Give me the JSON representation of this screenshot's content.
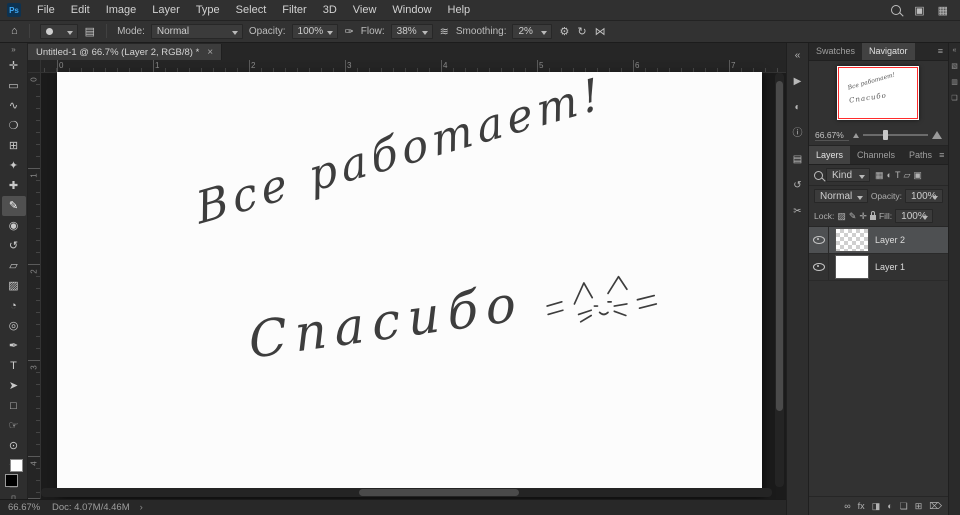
{
  "app": {
    "logo": "Ps"
  },
  "menubar": {
    "items": [
      "File",
      "Edit",
      "Image",
      "Layer",
      "Type",
      "Select",
      "Filter",
      "3D",
      "View",
      "Window",
      "Help"
    ],
    "workspace_icon": "▣",
    "arrange_icon": "▦"
  },
  "options": {
    "home_icon": "⌂",
    "brush_panel_icon": "▤",
    "mode": {
      "label": "Mode:",
      "value": "Normal"
    },
    "opacity": {
      "label": "Opacity:",
      "value": "100%"
    },
    "pressure_icon": "✑",
    "flow": {
      "label": "Flow:",
      "value": "38%"
    },
    "airbrush_icon": "≋",
    "smoothing": {
      "label": "Smoothing:",
      "value": "2%"
    },
    "gear_icon": "⚙",
    "angle_icon": "↻",
    "symmetry_icon": "⋈"
  },
  "tab": {
    "title": "Untitled-1 @ 66.7% (Layer 2, RGB/8) *",
    "close": "×"
  },
  "toolbar": {
    "collapse_icon": "»",
    "more_icon": "…",
    "tools": [
      {
        "name": "move-tool",
        "glyph": "✛",
        "selected": false
      },
      {
        "name": "marquee-tool",
        "glyph": "▭",
        "selected": false
      },
      {
        "name": "lasso-tool",
        "glyph": "∿",
        "selected": false
      },
      {
        "name": "quick-selection-tool",
        "glyph": "❍",
        "selected": false
      },
      {
        "name": "crop-tool",
        "glyph": "⊞",
        "selected": false
      },
      {
        "name": "eyedropper-tool",
        "glyph": "✦",
        "selected": false
      },
      {
        "name": "healing-brush-tool",
        "glyph": "✚",
        "selected": false
      },
      {
        "name": "brush-tool",
        "glyph": "✎",
        "selected": true
      },
      {
        "name": "clone-stamp-tool",
        "glyph": "◉",
        "selected": false
      },
      {
        "name": "history-brush-tool",
        "glyph": "↺",
        "selected": false
      },
      {
        "name": "eraser-tool",
        "glyph": "▱",
        "selected": false
      },
      {
        "name": "gradient-tool",
        "glyph": "▨",
        "selected": false
      },
      {
        "name": "blur-tool",
        "glyph": "◔",
        "selected": false
      },
      {
        "name": "dodge-tool",
        "glyph": "◎",
        "selected": false
      },
      {
        "name": "pen-tool",
        "glyph": "✒",
        "selected": false
      },
      {
        "name": "type-tool",
        "glyph": "T",
        "selected": false
      },
      {
        "name": "path-selection-tool",
        "glyph": "➤",
        "selected": false
      },
      {
        "name": "rectangle-tool",
        "glyph": "□",
        "selected": false
      },
      {
        "name": "hand-tool",
        "glyph": "☞",
        "selected": false
      },
      {
        "name": "zoom-tool",
        "glyph": "⊙",
        "selected": false
      }
    ]
  },
  "rulers": {
    "horizontal": [
      "0",
      "1",
      "2",
      "3",
      "4",
      "5",
      "6",
      "7"
    ],
    "vertical": [
      "0",
      "1",
      "2",
      "3",
      "4"
    ]
  },
  "canvas": {
    "text_line1": "Все работает!",
    "text_line2": "Спасибо",
    "doodle": "cat face doodle with ears and whiskers",
    "ink_color": "#3d3d3d"
  },
  "statusbar": {
    "zoom": "66.67%",
    "doc": "Doc: 4.07M/4.46M",
    "caret": "›"
  },
  "panels": {
    "dock_icons": [
      {
        "name": "collapse-dock-icon",
        "glyph": "«"
      },
      {
        "name": "actions-panel-icon",
        "glyph": "▶"
      },
      {
        "name": "adjustments-panel-icon",
        "glyph": "◐"
      },
      {
        "name": "info-panel-icon",
        "glyph": "ⓘ"
      },
      {
        "name": "properties-panel-icon",
        "glyph": "▤"
      },
      {
        "name": "history-panel-icon",
        "glyph": "↺"
      },
      {
        "name": "scissors-icon",
        "glyph": "✂"
      }
    ],
    "edge_icons": [
      {
        "name": "expand-dock-icon",
        "glyph": "«"
      },
      {
        "name": "color-panel-icon",
        "glyph": "▧"
      },
      {
        "name": "gradients-panel-icon",
        "glyph": "▥"
      },
      {
        "name": "patterns-panel-icon",
        "glyph": "❑"
      }
    ],
    "navigator": {
      "tabs": [
        {
          "label": "Swatches",
          "active": false
        },
        {
          "label": "Navigator",
          "active": true
        }
      ],
      "menu_icon": "≡",
      "zoom": "66.67%",
      "frame_color": "#ff2b2b"
    },
    "layers": {
      "tabs": [
        {
          "label": "Layers",
          "active": true
        },
        {
          "label": "Channels",
          "active": false
        },
        {
          "label": "Paths",
          "active": false
        }
      ],
      "menu_icon": "≡",
      "kind": "Kind",
      "filter_icons": [
        {
          "name": "pixel-layer-filter-icon",
          "glyph": "▦"
        },
        {
          "name": "adjustment-layer-filter-icon",
          "glyph": "◐"
        },
        {
          "name": "type-layer-filter-icon",
          "glyph": "T"
        },
        {
          "name": "shape-layer-filter-icon",
          "glyph": "▱"
        },
        {
          "name": "smart-object-filter-icon",
          "glyph": "▣"
        }
      ],
      "blend": "Normal",
      "opacity_label": "Opacity:",
      "opacity": "100%",
      "lock_label": "Lock:",
      "lock_icons": [
        {
          "name": "lock-transparency-icon",
          "glyph": "▨"
        },
        {
          "name": "lock-image-icon",
          "glyph": "✎"
        },
        {
          "name": "lock-position-icon",
          "glyph": "✛"
        },
        {
          "name": "lock-all-icon",
          "glyph": ""
        }
      ],
      "fill_label": "Fill:",
      "fill": "100%",
      "rows": [
        {
          "name": "Layer 2",
          "selected": true,
          "thumb": "checker"
        },
        {
          "name": "Layer 1",
          "selected": false,
          "thumb": "white"
        }
      ],
      "bottom_icons": [
        {
          "name": "link-layers-icon",
          "glyph": "∞"
        },
        {
          "name": "layer-effects-icon",
          "glyph": "fx"
        },
        {
          "name": "layer-mask-icon",
          "glyph": "◨"
        },
        {
          "name": "adjustment-layer-icon",
          "glyph": "◐"
        },
        {
          "name": "layer-group-icon",
          "glyph": "❏"
        },
        {
          "name": "new-layer-icon",
          "glyph": "⊞"
        },
        {
          "name": "delete-layer-icon",
          "glyph": "⌦"
        }
      ]
    }
  },
  "colors": {
    "ps_blue": "#31a8ff",
    "selected_row": "#4e5052",
    "panel_bg": "#323232",
    "canvas_bg": "#fcfcfc"
  }
}
